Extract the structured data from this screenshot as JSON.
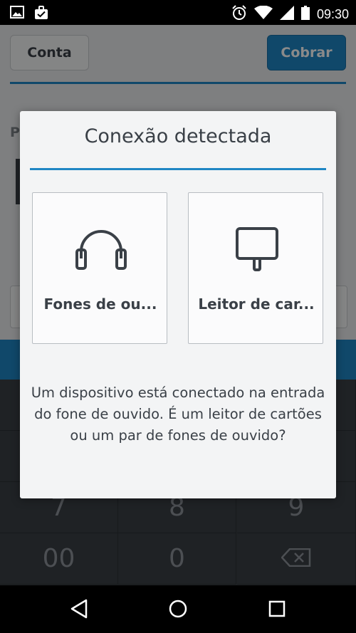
{
  "status_bar": {
    "time": "09:30",
    "icons": [
      "image-icon",
      "briefcase-check-icon",
      "alarm-icon",
      "wifi-icon",
      "signal-icon",
      "battery-icon"
    ]
  },
  "background_app": {
    "conta_label": "Conta",
    "cobrar_label": "Cobrar",
    "partial_label": "P",
    "keypad": [
      [
        "7",
        "8",
        "9"
      ],
      [
        "00",
        "0",
        "backspace-icon"
      ]
    ],
    "accent_color": "#1f86c4"
  },
  "dialog": {
    "title": "Conexão detectada",
    "options": [
      {
        "label": "Fones de ou...",
        "icon": "headphones-icon"
      },
      {
        "label": "Leitor de car...",
        "icon": "card-reader-icon"
      }
    ],
    "message": "Um dispositivo está conectado na entrada do fone de ouvido. É um leitor de cartões ou um par de fones de ouvido?"
  },
  "nav_bar": {
    "buttons": [
      "back-icon",
      "home-icon",
      "recents-icon"
    ]
  }
}
